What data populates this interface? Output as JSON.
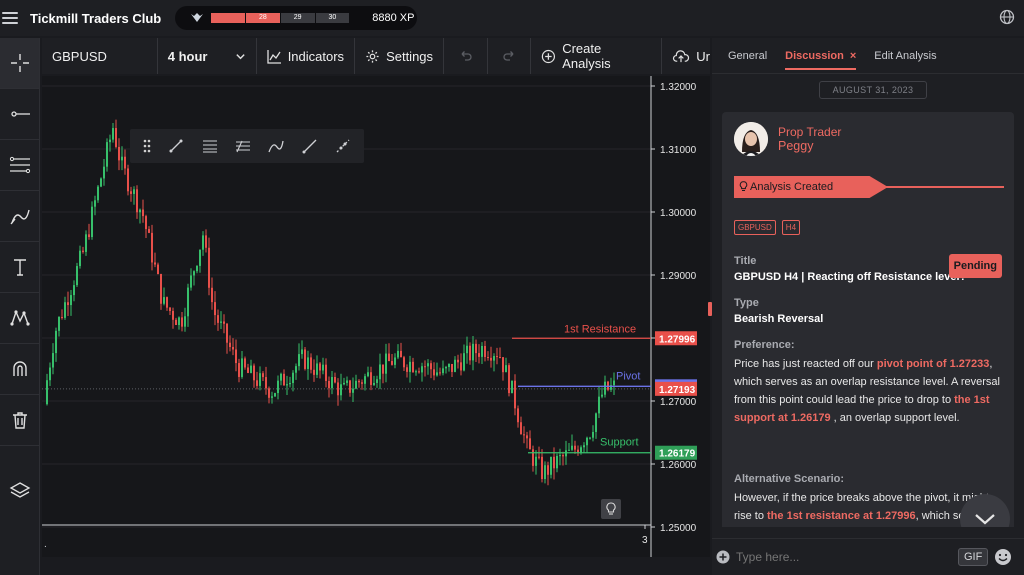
{
  "app": {
    "title": "Tickmill Traders Club"
  },
  "xp": {
    "segments": [
      "",
      "28",
      "29",
      "30"
    ],
    "value": "8880 XP",
    "progress_fraction": 0.5
  },
  "toolbar": {
    "symbol": "GBPUSD",
    "timeframe": "4 hour",
    "indicators": "Indicators",
    "settings": "Settings",
    "create_analysis": "Create Analysis",
    "upload": "Ur"
  },
  "chart": {
    "price_labels": [
      "1.32000",
      "1.31000",
      "1.30000",
      "1.29000",
      "1.28000",
      "1.27000",
      "1.26000",
      "1.25000"
    ],
    "x_tick": "3",
    "x_tick_left": ".",
    "levels": {
      "resistance": {
        "label": "1st Resistance",
        "price": "1.27996",
        "color": "#e8504a"
      },
      "pivot": {
        "label": "Pivot",
        "price": "1.27233",
        "color": "#6b73e8"
      },
      "current": {
        "price": "1.27193",
        "color": "#e8504a"
      },
      "support": {
        "label": "Support",
        "price": "1.26179",
        "color": "#37c06b"
      }
    },
    "colors": {
      "up": "#37c06b",
      "down": "#e8504a"
    }
  },
  "panel": {
    "tabs": [
      "General",
      "Discussion",
      "Edit Analysis"
    ],
    "active_tab": "Discussion",
    "close_glyph": "×",
    "date": "AUGUST 31, 2023",
    "author": {
      "role": "Prop Trader",
      "name": "Peggy"
    },
    "banner": "Analysis Created",
    "tags": [
      "GBPUSD",
      "H4"
    ],
    "status": "Pending",
    "title_label": "Title",
    "title_value": "GBPUSD H4 | Reacting off Resistance level?",
    "type_label": "Type",
    "type_value": "Bearish Reversal",
    "preference_label": "Preference:",
    "preference": {
      "t1": "Price has just reacted off our ",
      "h1": "pivot point of 1.27233",
      "t2": ", which serves as an overlap resistance level. A reversal from this point could lead the price to drop to ",
      "h2": "the 1st support at 1.26179",
      "t3": " , an overlap support level."
    },
    "alt_label": "Alternative Scenario:",
    "alt": {
      "t1": " However, if the price breaks above the pivot, it might rise to ",
      "h1": "the 1st resistance at 1.27996",
      "t2": ", which serves as a"
    },
    "composer_placeholder": "Type here...",
    "gif": "GIF"
  }
}
